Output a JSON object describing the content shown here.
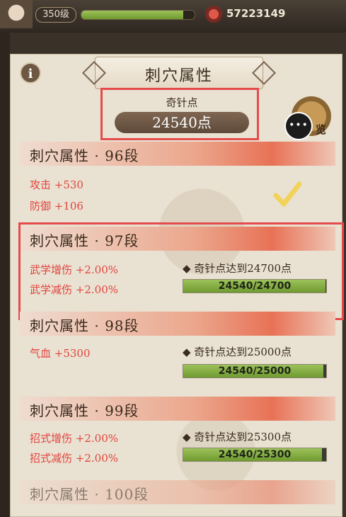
{
  "status": {
    "level": "350级",
    "currency": "57223149",
    "xp_progress": 0.9
  },
  "panel": {
    "title": "刺穴属性",
    "points_label": "奇针点",
    "points_value": "24540点",
    "chat_side_text": "览"
  },
  "tiers": [
    {
      "title": "刺穴属性 · 96段",
      "attrs": [
        "攻击 +530",
        "防御 +106"
      ],
      "completed": true
    },
    {
      "title": "刺穴属性 · 97段",
      "attrs": [
        "武学增伤 +2.00%",
        "武学减伤 +2.00%"
      ],
      "requirement": "◆ 奇针点达到24700点",
      "progress_text": "24540/24700",
      "current": 24540,
      "target": 24700
    },
    {
      "title": "刺穴属性 · 98段",
      "attrs": [
        "气血 +5300"
      ],
      "requirement": "◆ 奇针点达到25000点",
      "progress_text": "24540/25000",
      "current": 24540,
      "target": 25000
    },
    {
      "title": "刺穴属性 · 99段",
      "attrs": [
        "招式增伤 +2.00%",
        "招式减伤 +2.00%"
      ],
      "requirement": "◆ 奇针点达到25300点",
      "progress_text": "24540/25300",
      "current": 24540,
      "target": 25300
    },
    {
      "title": "刺穴属性 · 100段"
    }
  ],
  "colors": {
    "attr_red": "#e2443d",
    "highlight_red": "#e64b4b",
    "progress_green": "#8cb84a"
  },
  "icons": [
    "info-icon",
    "chat-icon",
    "checkmark-icon",
    "gem-icon"
  ]
}
